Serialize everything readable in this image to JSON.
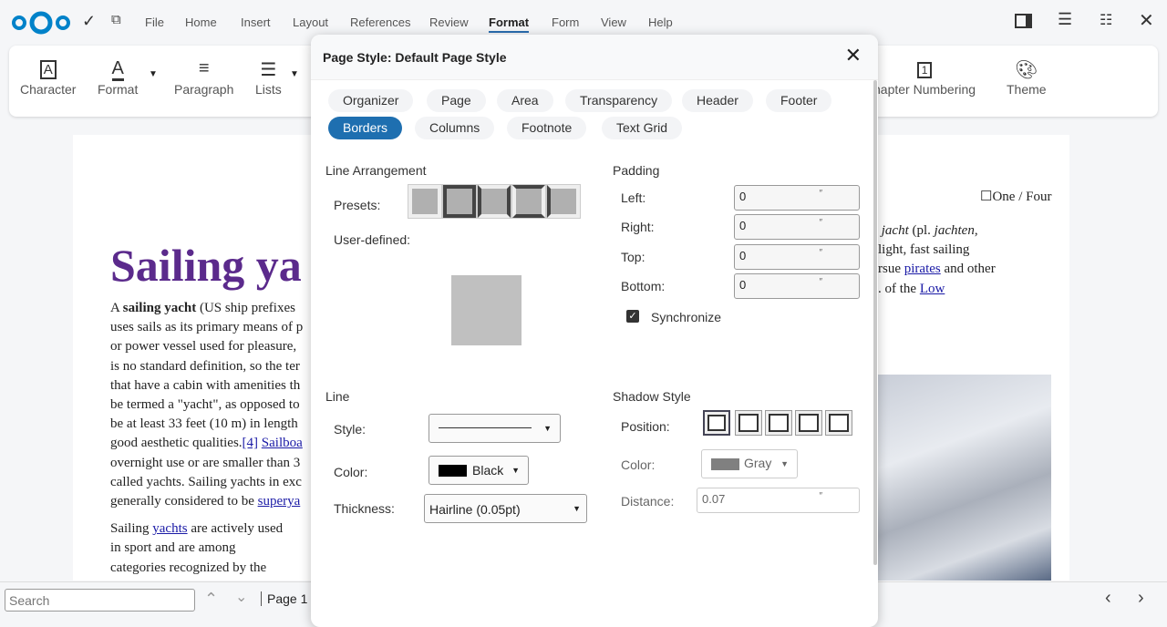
{
  "app": {
    "menus": [
      "File",
      "Home",
      "Insert",
      "Layout",
      "References",
      "Review",
      "Format",
      "Form",
      "View",
      "Help"
    ],
    "active_menu": "Format"
  },
  "toolbar": {
    "character": "Character",
    "format": "Format",
    "paragraph": "Paragraph",
    "lists": "Lists",
    "chapter_numbering": "hapter Numbering",
    "theme": "Theme"
  },
  "document": {
    "title": "Sailing ya",
    "header_field": "☐One / Four",
    "left_lines": [
      "uses sails as its primary means of p",
      "or power vessel used for pleasure,",
      "is no standard definition, so the ter",
      "that have a cabin with amenities th",
      "be termed a \"yacht\", as opposed to",
      "be at least 33 feet (10 m) in length"
    ],
    "p1_start": "A ",
    "p1_bold": "sailing yacht",
    "p1_rest": " (US ship prefixes",
    "line8_text": "good aesthetic qualities.",
    "line8_link1": "[4]",
    "line8_link2": "Sailboa",
    "line9": "overnight use or are smaller than 3",
    "line10": "called yachts. Sailing yachts in exc",
    "line11_text": "generally considered to be ",
    "line11_link": "superya",
    "p2_a": "Sailing ",
    "p2_link": "yachts",
    "p2_b": " are actively used",
    "p2_l2": "in sport and are among",
    "p2_l3": "categories recognized by the",
    "right_l1_a": "jacht",
    "right_l1_b": " (pl. ",
    "right_l1_c": "jachten",
    "right_l1_d": ",",
    "right_l2": "light, fast sailing",
    "right_l3_a": "rsue ",
    "right_l3_link": "pirates",
    "right_l3_b": " and other",
    "right_l4_a": ". of the ",
    "right_l4_link": "Low "
  },
  "dialog": {
    "title": "Page Style: Default Page Style",
    "tabs": [
      "Organizer",
      "Page",
      "Area",
      "Transparency",
      "Header",
      "Footer",
      "Borders",
      "Columns",
      "Footnote",
      "Text Grid"
    ],
    "active_tab": "Borders",
    "line_arrangement": "Line Arrangement",
    "presets_label": "Presets:",
    "user_defined_label": "User-defined:",
    "padding": {
      "title": "Padding",
      "left_label": "Left:",
      "left": "0",
      "right_label": "Right:",
      "right": "0",
      "top_label": "Top:",
      "top": "0",
      "bottom_label": "Bottom:",
      "bottom": "0",
      "unit": "″",
      "synchronize": "Synchronize",
      "synchronize_checked": true
    },
    "line": {
      "title": "Line",
      "style_label": "Style:",
      "color_label": "Color:",
      "color": "Black",
      "color_hex": "#000000",
      "thickness_label": "Thickness:",
      "thickness": "Hairline (0.05pt)"
    },
    "shadow": {
      "title": "Shadow Style",
      "position_label": "Position:",
      "color_label": "Color:",
      "color": "Gray",
      "color_hex": "#808080",
      "distance_label": "Distance:",
      "distance": "0.07",
      "unit": "″"
    }
  },
  "statusbar": {
    "search_placeholder": "Search",
    "page": "Page 1"
  }
}
